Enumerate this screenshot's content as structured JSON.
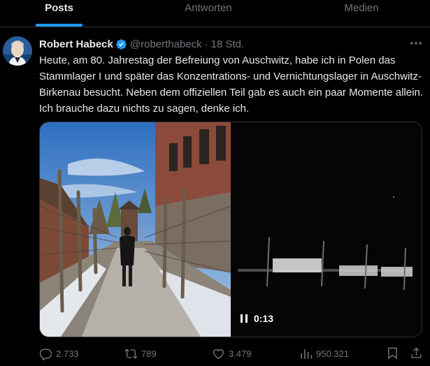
{
  "tabs": [
    {
      "label": "Posts",
      "active": true
    },
    {
      "label": "Antworten",
      "active": false
    },
    {
      "label": "Medien",
      "active": false
    }
  ],
  "tweet": {
    "author_name": "Robert Habeck",
    "handle": "@roberthabeck",
    "separator": "·",
    "time": "18 Std.",
    "text": "Heute, am 80. Jahrestag der Befreiung von Auschwitz, habe ich in Polen das Stammlager I und später das Konzentrations- und Vernichtungslager in Auschwitz-Birkenau besucht. Neben dem offiziellen Teil gab es auch ein paar Momente allein. Ich brauche dazu nichts zu sagen, denke ich.",
    "video_time": "0:13",
    "verified_color": "#1d9bf0"
  },
  "actions": {
    "replies": "2.733",
    "reposts": "789",
    "likes": "3.479",
    "views": "950.321"
  },
  "icons": [
    "verified-badge-icon",
    "more-icon",
    "pause-icon",
    "reply-icon",
    "repost-icon",
    "like-icon",
    "views-icon",
    "bookmark-icon",
    "share-icon"
  ],
  "colors": {
    "background": "#000000",
    "text": "#e7e9ea",
    "muted": "#71767b",
    "accent": "#1d9bf0",
    "border": "#2f3336"
  }
}
